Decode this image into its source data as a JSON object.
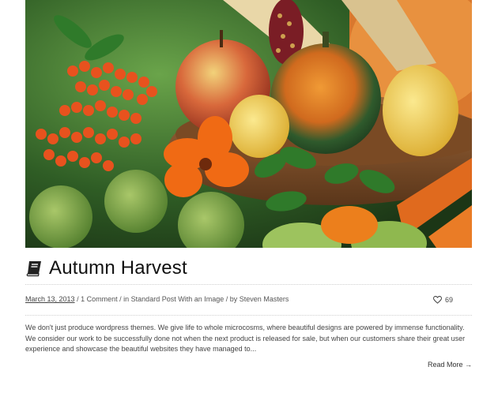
{
  "post": {
    "title": "Autumn Harvest",
    "date": "March 13, 2013",
    "comments": "1 Comment",
    "category_prefix": "in",
    "category": "Standard Post With an Image",
    "author_prefix": "by",
    "author": "Steven Masters",
    "likes": "69",
    "excerpt": "We don't just produce wordpress themes. We give life to whole microcosms, where beautiful designs are powered by immense functionality. We consider our work to be successfully done not when the next product is released for sale, but when our customers share their great user experience and showcase the beautiful websites they have managed to...",
    "read_more": "Read More →"
  },
  "icons": {
    "title_icon": "book-icon",
    "likes_icon": "heart-icon"
  },
  "colors": {
    "title": "#111111",
    "text": "#444444",
    "divider": "#cfcfcf"
  }
}
